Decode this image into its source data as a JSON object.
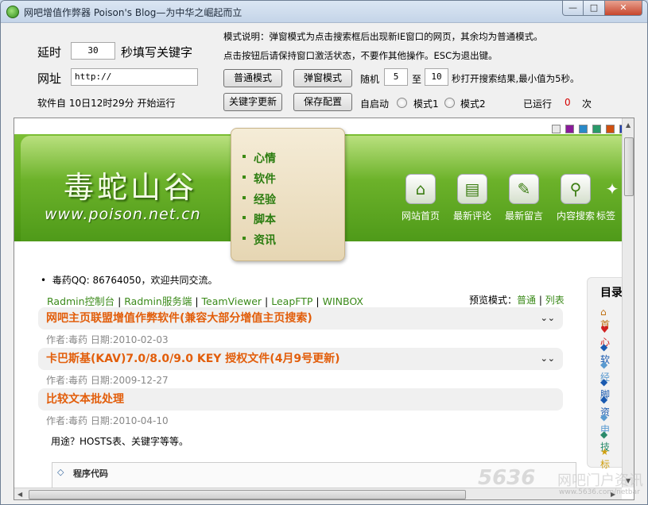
{
  "window": {
    "title": "网吧增值作弊器 Poison's Blog—为中华之崛起而立",
    "min": "—",
    "max": "□",
    "close": "✕"
  },
  "controls": {
    "delay_label": "延时",
    "delay_value": "30",
    "delay_suffix": "秒填写关键字",
    "url_label": "网址",
    "url_value": "http://",
    "start_label": "软件自 10日12时29分 开始运行",
    "mode_desc1": "模式说明：弹窗模式为点击搜索框后出现新IE窗口的网页，其余均为普通模式。",
    "mode_desc2": "点击按钮后请保持窗口激活状态，不要作其他操作。ESC为退出键。",
    "btn_normal": "普通模式",
    "btn_popup": "弹窗模式",
    "random_label": "随机",
    "random_min": "5",
    "to_label": "至",
    "random_max": "10",
    "random_suffix": "秒打开搜索结果,最小值为5秒。",
    "btn_keyword": "关键字更新",
    "btn_save": "保存配置",
    "autostart_label": "自启动",
    "mode1_label": "模式1",
    "mode2_label": "模式2",
    "runs_label": "已运行",
    "runs_count": "0",
    "runs_unit": "次"
  },
  "site": {
    "logo_cn": "毒蛇山谷",
    "logo_url": "www.poison.net.cn",
    "menu": [
      "心情",
      "软件",
      "经验",
      "脚本",
      "资讯"
    ],
    "nav": [
      {
        "label": "网站首页",
        "icon": "⌂"
      },
      {
        "label": "最新评论",
        "icon": "▤"
      },
      {
        "label": "最新留言",
        "icon": "✎"
      },
      {
        "label": "内容搜索",
        "icon": "⚲"
      },
      {
        "label": "标签",
        "icon": "✦"
      }
    ],
    "swatches": [
      "#e8e8e8",
      "#8a1a9a",
      "#2a8ac8",
      "#2a9a6a",
      "#d05010",
      "#2040b0"
    ],
    "qq_line": "毒药QQ: 86764050，欢迎共同交流。",
    "links": [
      "Radmin控制台",
      "Radmin服务端",
      "TeamViewer",
      "LeapFTP",
      "WINBOX"
    ],
    "link_sep": "|",
    "preview_label": "预览模式：",
    "preview_normal": "普通",
    "preview_list": "列表",
    "posts": [
      {
        "title": "网吧主页联盟增值作弊软件(兼容大部分增值主页搜索)",
        "meta": "作者:毒药 日期:2010-02-03"
      },
      {
        "title": "卡巴斯基(KAV)7.0/8.0/9.0 KEY 授权文件(4月9号更新)",
        "meta": "作者:毒药 日期:2009-12-27"
      },
      {
        "title": "比较文本批处理",
        "meta": "作者:毒药 日期:2010-04-10"
      }
    ],
    "post_body": "用途？HOSTS表、关键字等等。",
    "code_label": "程序代码",
    "sidebar_title": "目录",
    "sidebar_chars": [
      "首",
      "心",
      "软",
      "经",
      "脚",
      "资",
      "申",
      "技",
      "标"
    ]
  },
  "watermark": {
    "brand": "5636",
    "brand_cn": "网吧门户资讯",
    "url": "www.5636.com/netbar"
  }
}
